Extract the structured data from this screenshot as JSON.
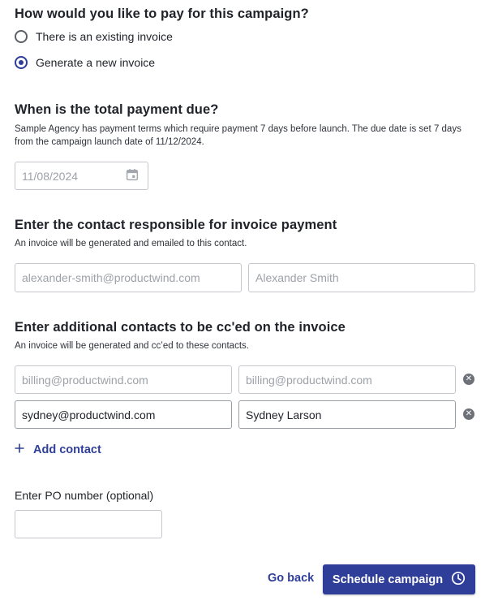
{
  "payment": {
    "heading": "How would you like to pay for this campaign?",
    "options": [
      {
        "label": "There is an existing invoice",
        "selected": false
      },
      {
        "label": "Generate a new invoice",
        "selected": true
      }
    ]
  },
  "due": {
    "heading": "When is the total payment due?",
    "description": "Sample Agency has payment terms which require payment 7 days before launch. The due date is set 7 days from the campaign launch date of 11/12/2024.",
    "date_value": "11/08/2024",
    "date_icon": "calendar-icon"
  },
  "contact": {
    "heading": "Enter the contact responsible for invoice payment",
    "description": "An invoice will be generated and emailed to this contact.",
    "email_placeholder": "alexander-smith@productwind.com",
    "name_placeholder": "Alexander Smith"
  },
  "cc": {
    "heading": "Enter additional contacts to be cc'ed on the invoice",
    "description": "An invoice will be generated and cc’ed to these contacts.",
    "rows": [
      {
        "email_placeholder": "billing@productwind.com",
        "email_value": "",
        "name_placeholder": "billing@productwind.com",
        "name_value": ""
      },
      {
        "email_placeholder": "",
        "email_value": "sydney@productwind.com",
        "name_placeholder": "",
        "name_value": "Sydney Larson"
      }
    ],
    "add_label": "Add contact",
    "remove_icon": "close-circle-icon"
  },
  "po": {
    "label": "Enter PO number (optional)",
    "value": ""
  },
  "footer": {
    "back_label": "Go back",
    "submit_label": "Schedule campaign",
    "submit_icon": "clock-icon"
  },
  "colors": {
    "accent": "#2f3e99",
    "text": "#1f2228",
    "placeholder": "#9da1a8",
    "border": "#c4c7cc"
  }
}
